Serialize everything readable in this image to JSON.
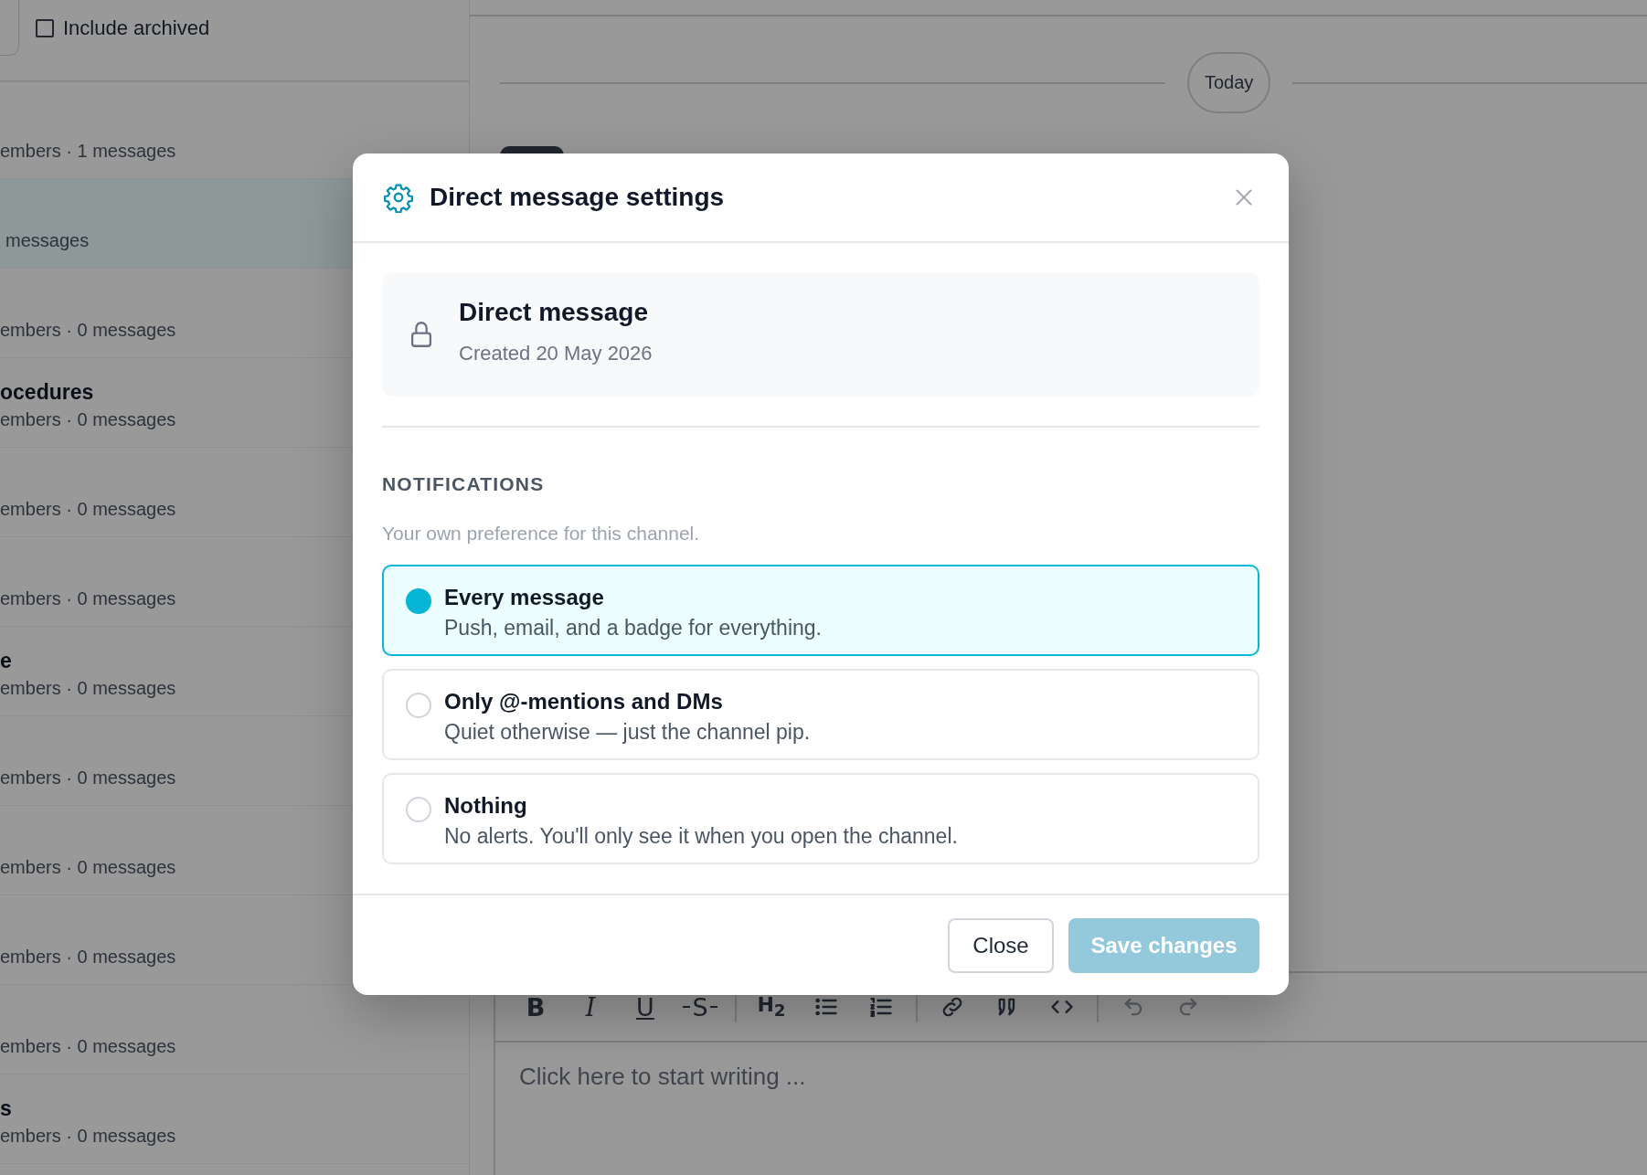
{
  "sidebar": {
    "filter": {
      "label": "Include archived",
      "checked": false
    },
    "rows": [
      {
        "meta": "embers · 1 messages",
        "selected": false
      },
      {
        "meta": "messages",
        "selected": true
      },
      {
        "meta": "embers · 0 messages",
        "selected": false
      },
      {
        "title": "ocedures",
        "meta": "embers · 0 messages",
        "selected": false
      },
      {
        "meta": "embers · 0 messages",
        "selected": false
      },
      {
        "meta": "embers · 0 messages",
        "selected": false
      },
      {
        "title": "e",
        "meta": "embers · 0 messages",
        "selected": false
      },
      {
        "meta": "embers · 0 messages",
        "selected": false
      },
      {
        "meta": "embers · 0 messages",
        "selected": false
      },
      {
        "meta": "embers · 0 messages",
        "selected": false
      },
      {
        "meta": "embers · 0 messages",
        "selected": false
      },
      {
        "title": "s",
        "meta": "embers · 0 messages",
        "selected": false
      }
    ]
  },
  "main": {
    "date_divider": "Today",
    "editor": {
      "toolbar": [
        [
          {
            "kind": "bold",
            "label": "B",
            "disabled": false
          },
          {
            "kind": "italic",
            "label": "I",
            "disabled": false
          },
          {
            "kind": "underline",
            "label": "U",
            "disabled": false
          },
          {
            "kind": "strike",
            "label": "S",
            "disabled": false
          }
        ],
        [
          {
            "kind": "heading",
            "label": "H$_{2}$",
            "disabled": false
          },
          {
            "kind": "bullets",
            "disabled": false
          },
          {
            "kind": "numbers",
            "disabled": false
          }
        ],
        [
          {
            "kind": "link",
            "disabled": false
          },
          {
            "kind": "quote",
            "disabled": false
          },
          {
            "kind": "code",
            "disabled": false
          }
        ],
        [
          {
            "kind": "undo",
            "disabled": true
          },
          {
            "kind": "redo",
            "disabled": true
          }
        ]
      ],
      "placeholder": "Click here to start writing ..."
    }
  },
  "dialog": {
    "title": "Direct message settings",
    "info": {
      "title": "Direct message",
      "subtitle": "Created 20 May 2026"
    },
    "section": "NOTIFICATIONS",
    "hint": "Your own preference for this channel.",
    "options": [
      {
        "title": "Every message",
        "description": "Push, email, and a badge for everything.",
        "selected": true
      },
      {
        "title": "Only @-mentions and DMs",
        "description": "Quiet otherwise — just the channel pip.",
        "selected": false
      },
      {
        "title": "Nothing",
        "description": "No alerts. You'll only see it when you open the channel.",
        "selected": false
      }
    ],
    "buttons": [
      {
        "label": "Close",
        "kind": "secondary",
        "disabled": false
      },
      {
        "label": "Save changes",
        "kind": "primary",
        "disabled": true
      }
    ]
  }
}
